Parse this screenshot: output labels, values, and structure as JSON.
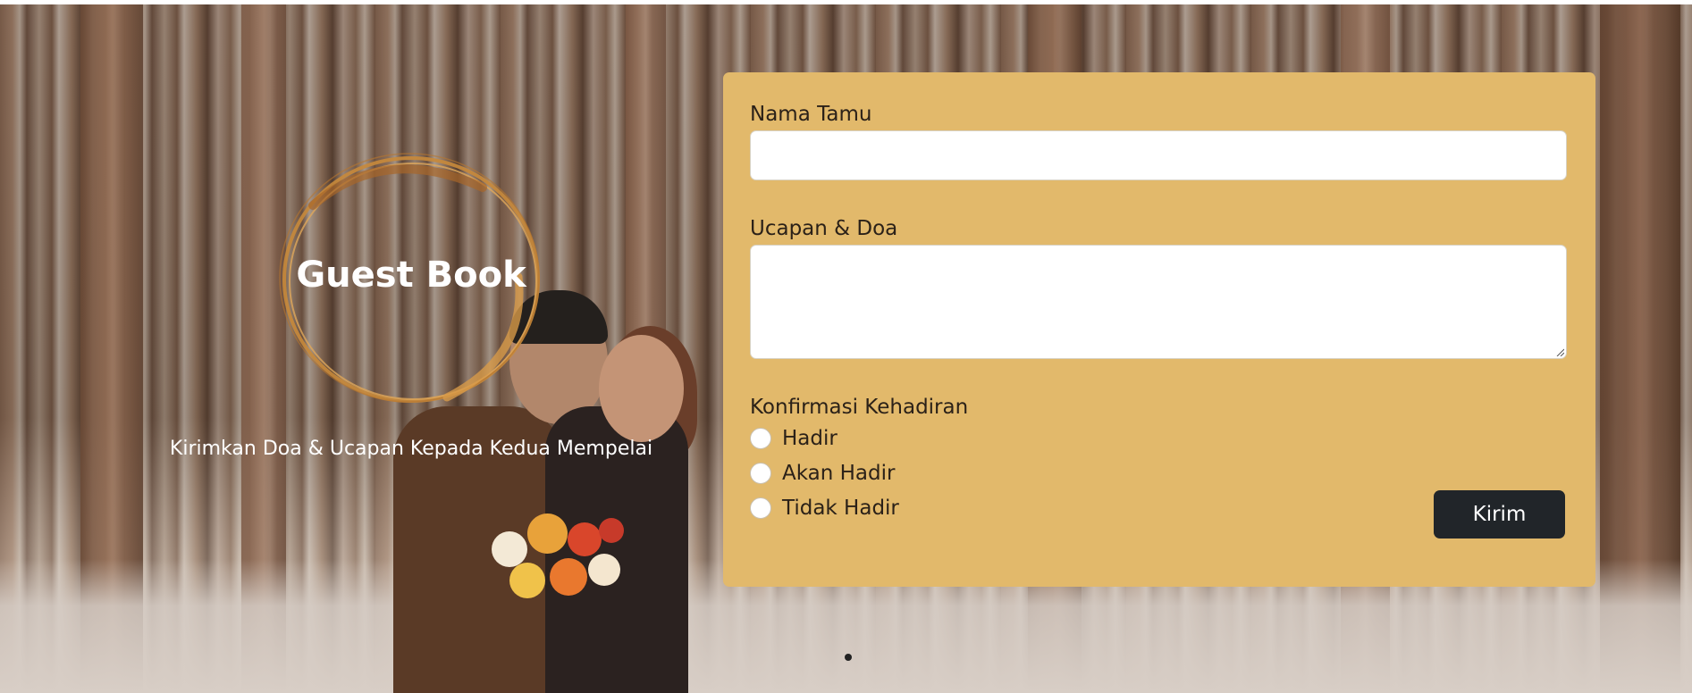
{
  "hero": {
    "title": "Guest Book",
    "subtitle": "Kirimkan Doa & Ucapan Kepada Kedua Mempelai"
  },
  "form": {
    "name_label": "Nama Tamu",
    "name_value": "",
    "message_label": "Ucapan & Doa",
    "message_value": "",
    "attendance_label": "Konfirmasi Kehadiran",
    "attendance_options": [
      "Hadir",
      "Akan Hadir",
      "Tidak Hadir"
    ],
    "submit_label": "Kirim"
  },
  "colors": {
    "card_background": "#e2b96b",
    "button_background": "#212529",
    "accent_gold": "#c8893b"
  },
  "icons": {
    "gold_ring": "brush-circle-icon",
    "carousel_indicator": "dot-icon"
  }
}
